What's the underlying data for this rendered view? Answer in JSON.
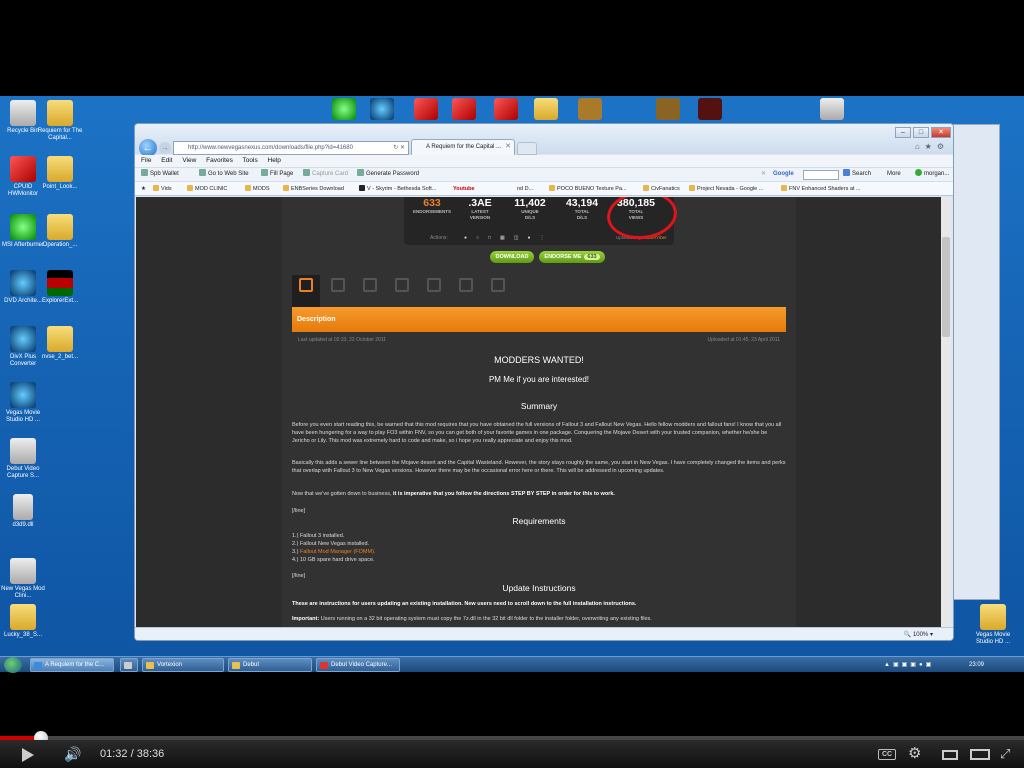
{
  "desktop": {
    "icons": [
      {
        "label": "Recycle Bin"
      },
      {
        "label": "Requiem for The Capital..."
      },
      {
        "label": "CPUID HWMonitor"
      },
      {
        "label": "Point_Look..."
      },
      {
        "label": "MSI Afterburner"
      },
      {
        "label": "Operation_..."
      },
      {
        "label": "DVD Archite..."
      },
      {
        "label": "ExplorerExt..."
      },
      {
        "label": "DivX Plus Converter"
      },
      {
        "label": "nvse_2_bet..."
      },
      {
        "label": "Vegas Movie Studio HD ..."
      },
      {
        "label": "Debut Video Capture S..."
      },
      {
        "label": "d3d9.dll"
      },
      {
        "label": "New Vegas Mod Clini..."
      },
      {
        "label": "Lucky_38_S..."
      },
      {
        "label": "Vegas Movie Studio HD ..."
      }
    ]
  },
  "browser": {
    "address": "http://www.newvegasnexus.com/downloads/file.php?id=41680",
    "tab_title": "A Requiem for the Capital ...",
    "menu": [
      "File",
      "Edit",
      "View",
      "Favorites",
      "Tools",
      "Help"
    ],
    "command_bar": {
      "wallet": "Spb Wallet",
      "go_to_web_site": "Go to Web Site",
      "fill_page": "Fill Page",
      "capture_card": "Capture Card",
      "generate_password": "Generate Password",
      "google": "Google",
      "search": "Search",
      "more": "More",
      "user": "morgan..."
    },
    "favorites": [
      "Vids",
      "MOD CLINIC",
      "MODS",
      "ENBSeries Download",
      "V - Skyrim - Bethesda Soft...",
      "Youtube",
      "nd D...",
      "POCO BUENO Texture Pa...",
      "CivFanatics",
      "Project Nevada - Google ...",
      "FNV Enhanced Shaders at ..."
    ],
    "zoom": "100%"
  },
  "page": {
    "stats": [
      {
        "num": "633",
        "label": "ENDORSEMENTS"
      },
      {
        "num": ".3AE",
        "label": "LATEST VERSION"
      },
      {
        "num": "11,402",
        "label": "UNIQUE D/LS"
      },
      {
        "num": "43,194",
        "label": "TOTAL D/LS"
      },
      {
        "num": "380,185",
        "label": "TOTAL VIEWS"
      }
    ],
    "actions_label": "Actions:",
    "uploaded_by_prefix": "Uploaded by",
    "uploaded_by_user": "MasterYiber",
    "download_btn": "DOWNLOAD",
    "endorse_btn": "ENDORSE ME",
    "endorse_count": "633",
    "tabs": [
      "",
      "",
      "",
      "",
      "",
      "",
      ""
    ],
    "desc_title": "Description",
    "last_updated": "Last updated at 02:33, 22 October 2011",
    "uploaded_at": "Uploaded at 01:45, 23 April 2011",
    "heading1": "MODDERS WANTED!",
    "heading2": "PM Me if you are interested!",
    "summary_title": "Summary",
    "summary_p1": "Before you even start reading this, be warned that this mod requires that you have obtained the full versions of Fallout 3 and Fallout New Vegas. Hello fellow modders and fallout fans! I know that you all have been hungering for a way to play FO3 within FNV, so you can get both of your favorite games in one package. Conquering the Mojave Desert with your trusted companion, whether he/she be Jericho or Lily. This mod was extremely hard to code and make, so i hope you really appreciate and enjoy this mod.",
    "summary_p2": "Basically this adds a sewer line between the Mojave desert and the Capital Wasteland. However, the story stays roughly the same, you start in New Vegas. I have completely changed the items and perks that overlap with Fallout 3 to New Vegas versions. However there may be the occasional error here or there. This will be addressed in upcoming updates.",
    "summary_p3_a": "Now that we've gotten down to business,",
    "summary_p3_b": "it is imperative that you follow the directions STEP BY STEP in order for this to work.",
    "line1": "[/line]",
    "req_title": "Requirements",
    "req": [
      "1.) Fallout 3 installed.",
      "2.) Fallout New Vegas installed.",
      "3.)",
      "4.) 10 GB spare hard drive space."
    ],
    "req3_link": "Fallout Mod Manager (FOMM).",
    "line2": "[/line]",
    "update_title": "Update Instructions",
    "update_p1": "These are instructions for users updating an existing installation. New users need to scroll down to the full installation instructions.",
    "update_p2_a": "Important:",
    "update_p2_b": "Users running on a 32 bit operating system must copy the 7z.dll in the 32 bit dll folder to the installer folder, overwriting any existing files."
  },
  "taskbar": {
    "buttons": [
      "A Requiem for the C...",
      "",
      "Vortexion",
      "Debut",
      "Debut Video Capture..."
    ],
    "clock": "23:09"
  },
  "player": {
    "current": "01:32",
    "duration": "38:36",
    "progress": 0.0397,
    "cc": "CC"
  },
  "colors": {
    "accent_orange": "#e8822a",
    "green_button": "#6fa81c",
    "annotation_red": "#e0141c",
    "player_red": "#cc0000"
  }
}
